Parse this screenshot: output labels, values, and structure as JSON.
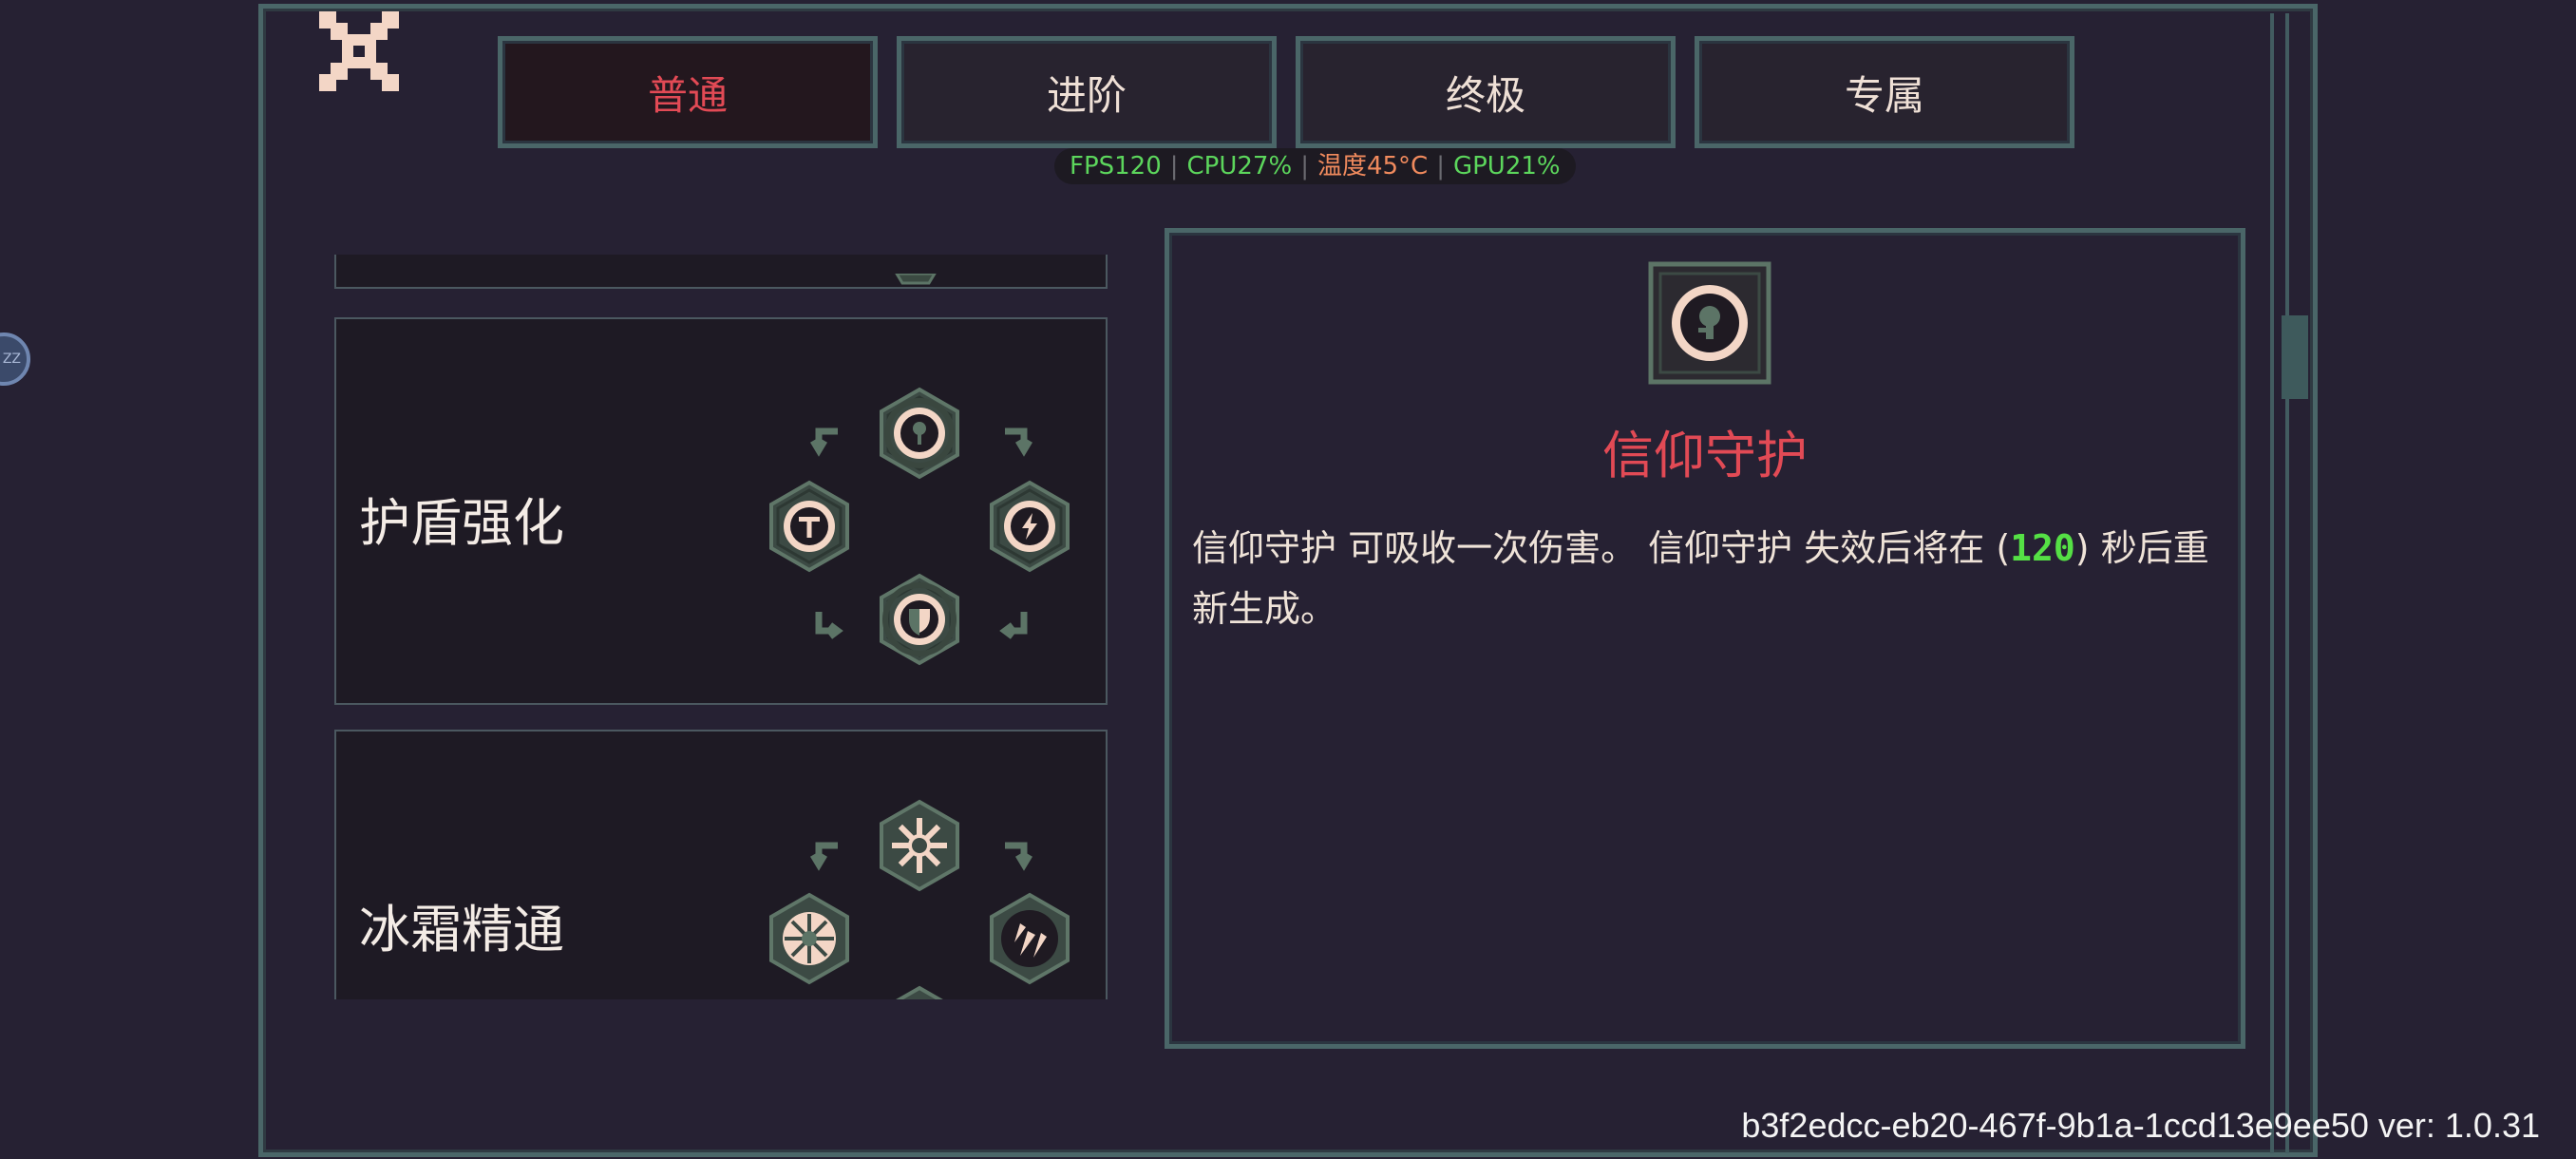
{
  "close": {
    "icon": "close-icon"
  },
  "tabs": [
    {
      "label": "普通",
      "active": true
    },
    {
      "label": "进阶",
      "active": false
    },
    {
      "label": "终极",
      "active": false
    },
    {
      "label": "专属",
      "active": false
    }
  ],
  "perf": {
    "fps": "FPS120",
    "cpu": "CPU27%",
    "temp": "温度45°C",
    "gpu": "GPU21%"
  },
  "side_bubble": {
    "label": "ZZ"
  },
  "talent_groups": [
    {
      "name": "护盾强化",
      "icons": [
        "faith-guard-icon",
        "sword-icon",
        "lightning-icon",
        "shield-icon"
      ]
    },
    {
      "name": "冰霜精通",
      "icons": [
        "snowflake-icon",
        "frost-burst-icon",
        "ice-shard-icon"
      ]
    }
  ],
  "detail": {
    "icon": "faith-guard-icon",
    "title": "信仰守护",
    "desc_part1": "信仰守护 可吸收一次伤害。 信仰守护 失效后将在 (",
    "desc_value": "120",
    "desc_part2": ") 秒后重新生成。"
  },
  "build_info": "b3f2edcc-eb20-467f-9b1a-1ccd13e9ee50 ver: 1.0.31",
  "colors": {
    "background": "#262133",
    "frame": "#4a6668",
    "accent_red": "#e24a55",
    "value_green": "#55e045",
    "icon_cream": "#f3d6c6",
    "icon_green": "#5c7466"
  }
}
